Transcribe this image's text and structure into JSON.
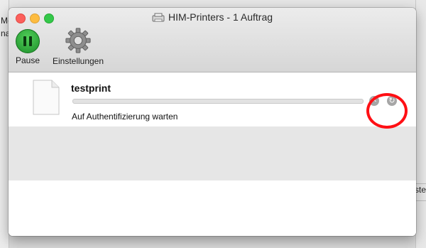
{
  "window": {
    "title": "HIM-Printers - 1 Auftrag"
  },
  "toolbar": {
    "pause_label": "Pause",
    "settings_label": "Einstellungen"
  },
  "job": {
    "name": "testprint",
    "status": "Auf Authentifizierung warten",
    "progress": 0
  },
  "icons": {
    "pause": "pause-icon",
    "settings": "gear-icon",
    "document": "document-icon",
    "cancel": "cancel-job-icon",
    "resume": "resume-job-icon",
    "printer": "printer-icon"
  },
  "background_fragments": {
    "left_top": "M‹",
    "left_second": "na",
    "right": "ste"
  },
  "colors": {
    "close": "#fc605c",
    "minimize": "#fdbc40",
    "maximize": "#34c84a",
    "pause": "#2aa83a",
    "annotation": "#ff0f14"
  }
}
